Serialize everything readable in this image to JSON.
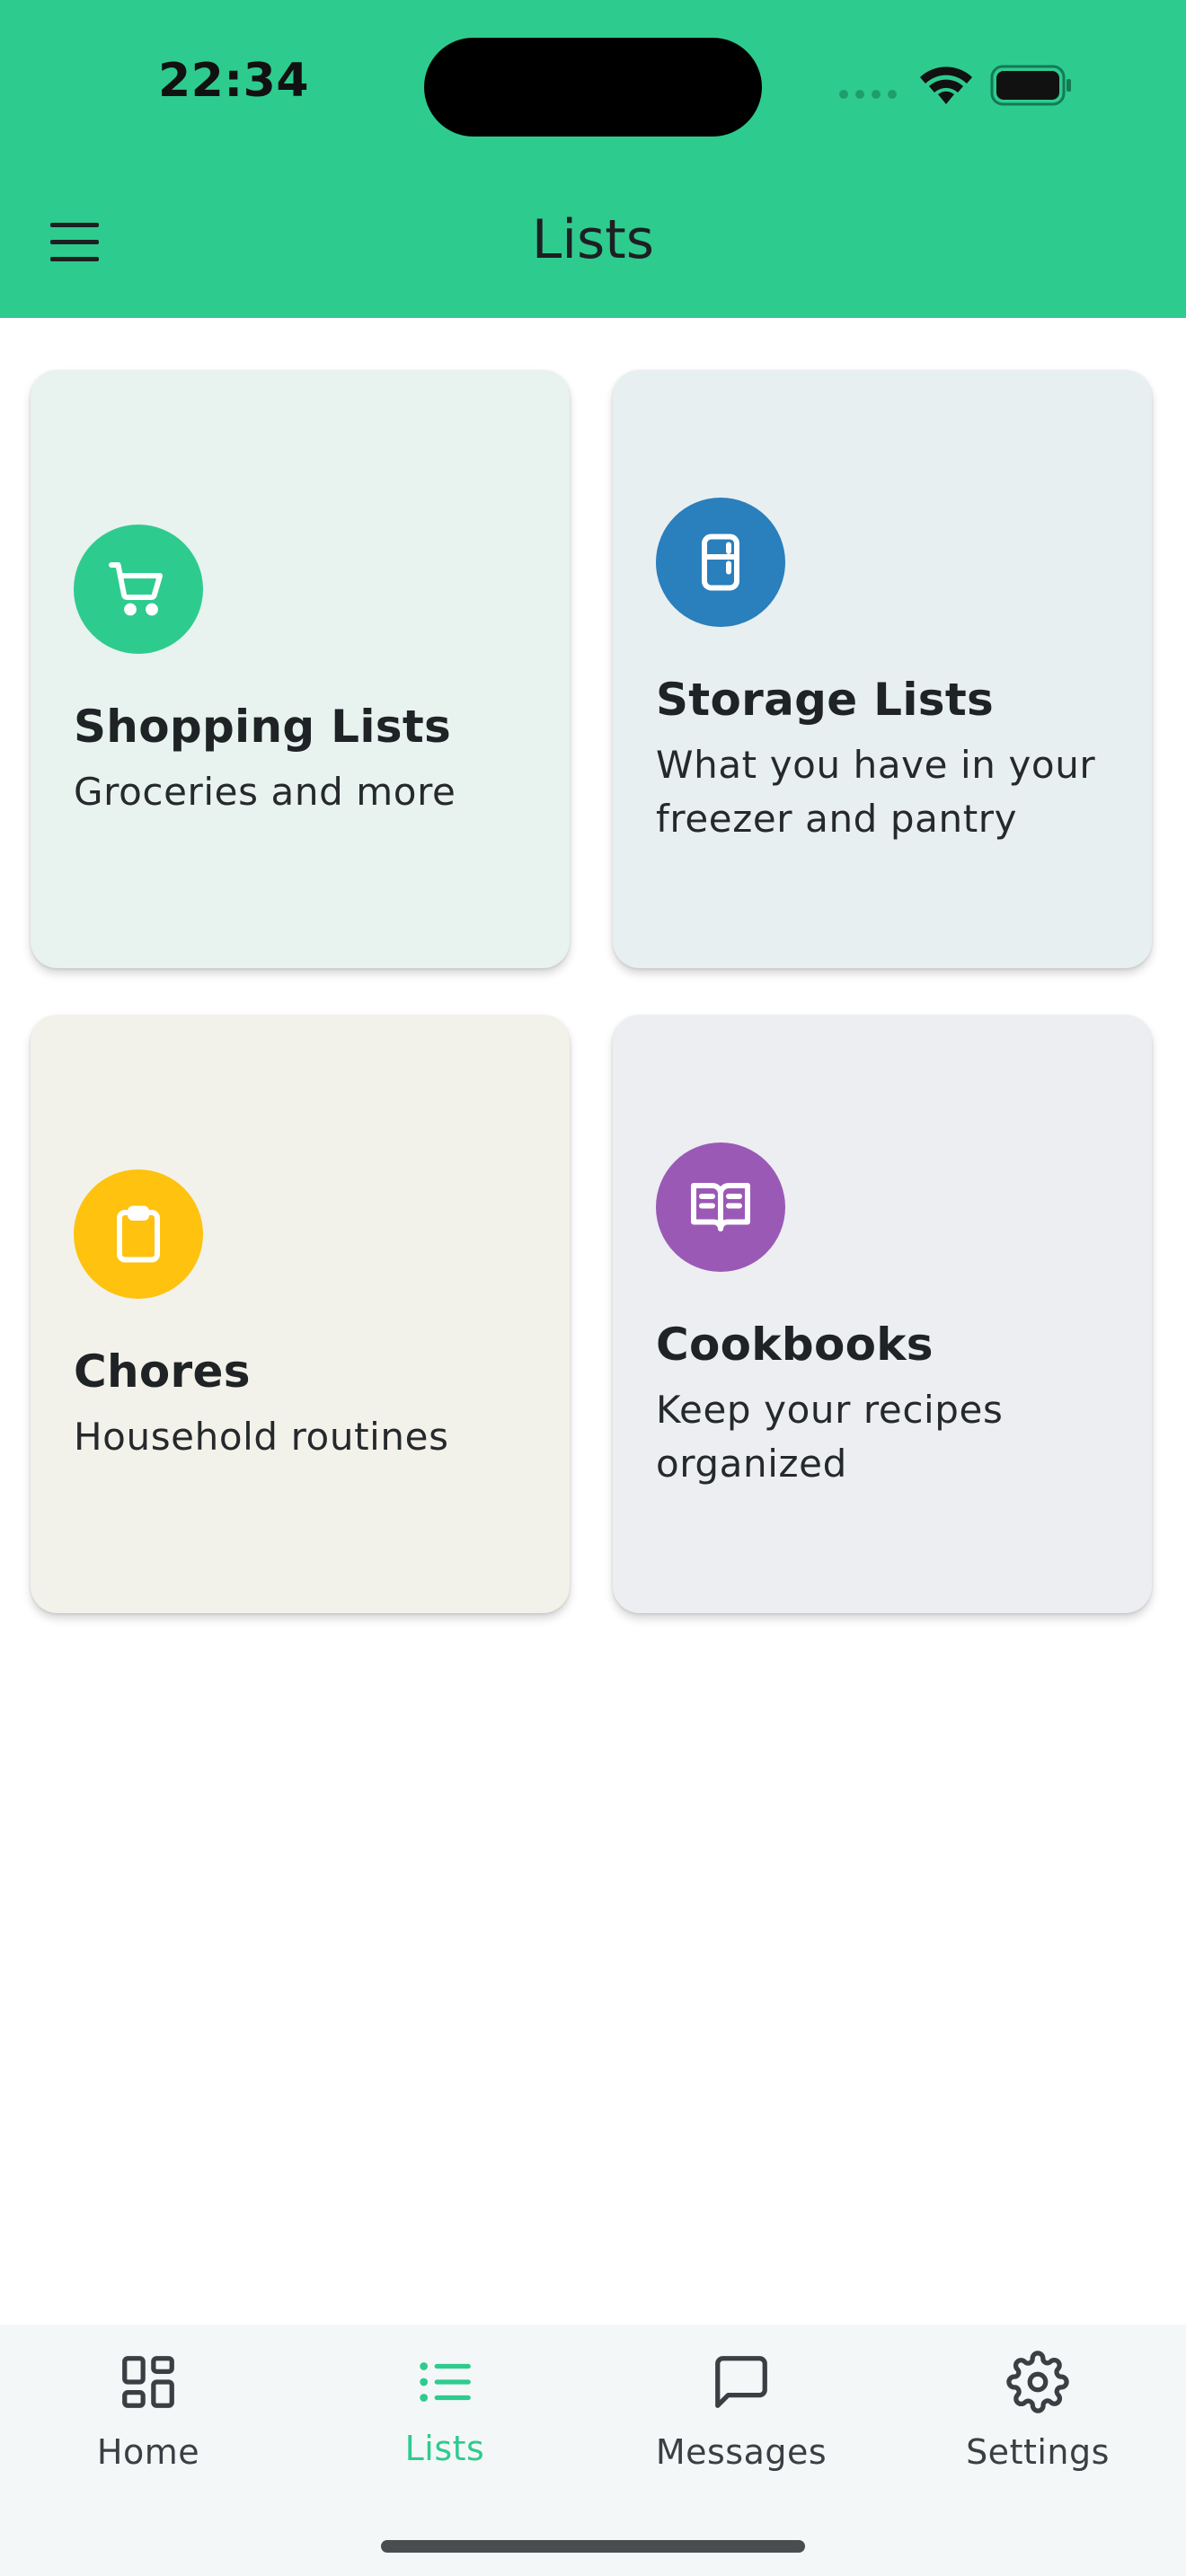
{
  "status_bar": {
    "time": "22:34"
  },
  "header": {
    "title": "Lists",
    "menu_icon": "hamburger-menu-icon"
  },
  "colors": {
    "brand": "#2ecb8f",
    "shopping": "#2ecb8f",
    "storage": "#2a7fbd",
    "chores": "#fec20f",
    "cookbooks": "#9b59b6"
  },
  "cards": [
    {
      "title": "Shopping Lists",
      "subtitle": "Groceries and more",
      "icon": "shopping-cart-icon"
    },
    {
      "title": "Storage Lists",
      "subtitle": "What you have in your freezer and pantry",
      "icon": "fridge-icon"
    },
    {
      "title": "Chores",
      "subtitle": "Household routines",
      "icon": "clipboard-icon"
    },
    {
      "title": "Cookbooks",
      "subtitle": "Keep your recipes organized",
      "icon": "book-open-icon"
    }
  ],
  "bottom_nav": {
    "selected": "Lists",
    "items": [
      {
        "label": "Home",
        "icon": "dashboard-icon"
      },
      {
        "label": "Lists",
        "icon": "list-icon"
      },
      {
        "label": "Messages",
        "icon": "message-icon"
      },
      {
        "label": "Settings",
        "icon": "gear-icon"
      }
    ]
  }
}
